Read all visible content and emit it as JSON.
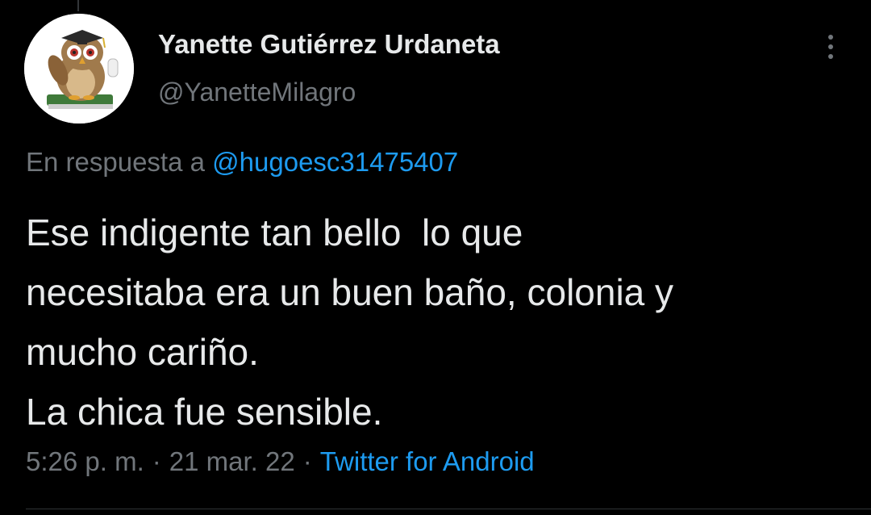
{
  "user": {
    "display_name": "Yanette Gutiérrez Urdaneta",
    "handle": "@YanetteMilagro",
    "avatar_icon": "owl-graduate-avatar"
  },
  "reply": {
    "prefix": "En respuesta a",
    "mention": "@hugoesc31475407"
  },
  "tweet": {
    "lines": [
      "Ese indigente tan bello  lo que",
      "necesitaba era un buen baño, colonia y",
      "mucho cariño.",
      "La chica fue sensible."
    ]
  },
  "meta": {
    "time": "5:26 p. m.",
    "separator": "·",
    "date": "21 mar. 22",
    "source": "Twitter for Android"
  },
  "colors": {
    "background": "#000000",
    "text": "#e7e9ea",
    "secondary": "#71767b",
    "link": "#1d9bf0"
  }
}
